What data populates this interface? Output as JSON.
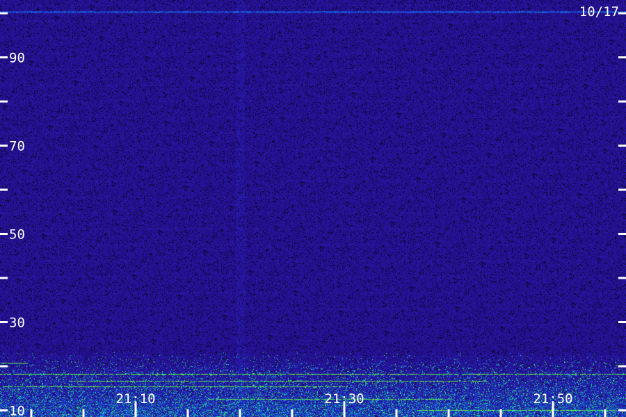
{
  "chart_data": {
    "type": "heatmap",
    "date_label": "10/17",
    "y_ticks": [
      {
        "value": 100,
        "label": ""
      },
      {
        "value": 90,
        "label": "90"
      },
      {
        "value": 80,
        "label": ""
      },
      {
        "value": 70,
        "label": "70"
      },
      {
        "value": 60,
        "label": ""
      },
      {
        "value": 50,
        "label": "50"
      },
      {
        "value": 40,
        "label": ""
      },
      {
        "value": 30,
        "label": "30"
      },
      {
        "value": 20,
        "label": ""
      },
      {
        "value": 10,
        "label": "10"
      }
    ],
    "ylim": [
      8.5,
      103
    ],
    "x_ticks": [
      {
        "value": "21:00",
        "label": ""
      },
      {
        "value": "21:05",
        "label": ""
      },
      {
        "value": "21:10",
        "label": "21:10"
      },
      {
        "value": "21:15",
        "label": ""
      },
      {
        "value": "21:20",
        "label": ""
      },
      {
        "value": "21:25",
        "label": ""
      },
      {
        "value": "21:30",
        "label": "21:30"
      },
      {
        "value": "21:35",
        "label": ""
      },
      {
        "value": "21:40",
        "label": ""
      },
      {
        "value": "21:45",
        "label": ""
      },
      {
        "value": "21:50",
        "label": "21:50"
      },
      {
        "value": "21:55",
        "label": ""
      }
    ],
    "xlim": [
      "20:57",
      "21:57"
    ],
    "colormap": [
      "#000000",
      "#1e0a6e",
      "#2a18b0",
      "#1060e0",
      "#10d0d0",
      "#40ff40",
      "#f0ff40"
    ],
    "grid": false
  }
}
